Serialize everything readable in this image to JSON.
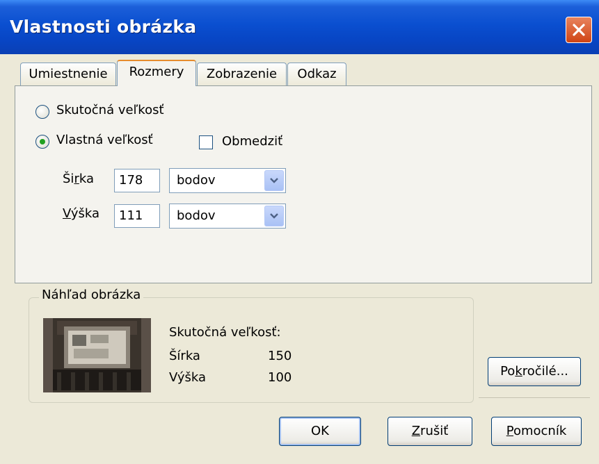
{
  "window": {
    "title": "Vlastnosti obrázka"
  },
  "tabs": [
    {
      "label": "Umiestnenie"
    },
    {
      "label": "Rozmery"
    },
    {
      "label": "Zobrazenie"
    },
    {
      "label": "Odkaz"
    }
  ],
  "size": {
    "actual_label": "Skutočná veľkosť",
    "custom_label": "Vlastná veľkosť",
    "constrain_label": "Obmedziť",
    "constrain_checked": false,
    "selected": "custom"
  },
  "width": {
    "label_pre": "Ši",
    "label_ul": "r",
    "label_post": "ka",
    "value": "178",
    "unit": "bodov"
  },
  "height": {
    "label_pre": "",
    "label_ul": "V",
    "label_post": "ýška",
    "value": "111",
    "unit": "bodov"
  },
  "preview": {
    "group_label": "Náhľad obrázka",
    "actual_size_label": "Skutočná veľkosť:",
    "width_label": "Šírka",
    "width_value": "150",
    "height_label": "Výška",
    "height_value": "100"
  },
  "buttons": {
    "advanced_pre": "Po",
    "advanced_ul": "k",
    "advanced_post": "ročilé...",
    "ok": "OK",
    "cancel_ul": "Z",
    "cancel_post": "rušiť",
    "help_ul": "P",
    "help_post": "omocník"
  },
  "colors": {
    "titlebar": "#0a4fd0",
    "face": "#ece9d8",
    "radio_dot": "#21a121",
    "close": "#d04414"
  }
}
